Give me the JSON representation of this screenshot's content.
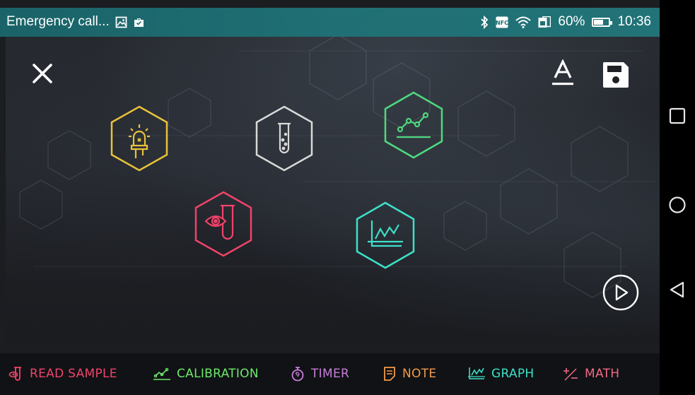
{
  "status_bar": {
    "notification_title": "Emergency call...",
    "battery_percent": "60%",
    "time": "10:36",
    "icons": [
      "image-icon",
      "briefcase-icon",
      "bluetooth-icon",
      "nfc-icon",
      "wifi-icon",
      "sim-icon",
      "battery-icon"
    ]
  },
  "header": {
    "close_icon": "close-icon",
    "text_format_icon": "text-format-icon",
    "save_icon": "save-icon"
  },
  "workflow_nodes": [
    {
      "id": "led",
      "icon": "led-icon",
      "color": "#e8c23a"
    },
    {
      "id": "test-tube",
      "icon": "test-tube-icon",
      "color": "#d9d9d9"
    },
    {
      "id": "calibration",
      "icon": "calibration-icon",
      "color": "#4fd97f"
    },
    {
      "id": "read-sample",
      "icon": "read-sample-icon",
      "color": "#f0436a"
    },
    {
      "id": "graph",
      "icon": "graph-icon",
      "color": "#3ee0c8"
    }
  ],
  "play_icon": "play-icon",
  "toolbar": {
    "items": [
      {
        "label": "READ SAMPLE",
        "icon": "read-sample-icon",
        "color": "#f0436a"
      },
      {
        "label": "CALIBRATION",
        "icon": "calibration-icon",
        "color": "#6ee86a"
      },
      {
        "label": "TIMER",
        "icon": "timer-icon",
        "color": "#c77dd9"
      },
      {
        "label": "NOTE",
        "icon": "note-icon",
        "color": "#f2994a"
      },
      {
        "label": "GRAPH",
        "icon": "graph-icon",
        "color": "#3ee0c8"
      },
      {
        "label": "MATH",
        "icon": "math-icon",
        "color": "#f06a86"
      }
    ]
  },
  "nav_bar": {
    "icons": [
      "recents-icon",
      "home-icon",
      "back-icon"
    ]
  }
}
